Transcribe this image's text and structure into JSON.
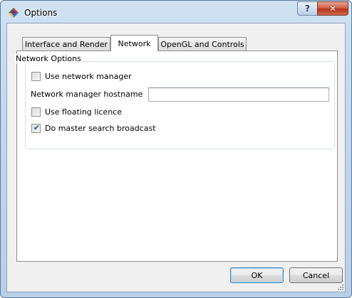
{
  "window": {
    "title": "Options",
    "help_label": "?",
    "close_label": "✕"
  },
  "tabs": [
    {
      "label": "Interface and Render",
      "active": false
    },
    {
      "label": "Network",
      "active": true
    },
    {
      "label": "OpenGL and Controls",
      "active": false
    }
  ],
  "network_options": {
    "group_title": "Network Options",
    "use_network_manager": {
      "label": "Use network manager",
      "checked": false
    },
    "hostname": {
      "label": "Network manager hostname",
      "value": "",
      "placeholder": ""
    },
    "use_floating_licence": {
      "label": "Use floating licence",
      "checked": false
    },
    "master_search_broadcast": {
      "label": "Do master search broadcast",
      "checked": true
    }
  },
  "buttons": {
    "ok_label": "OK",
    "cancel_label": "Cancel"
  },
  "icons": {
    "app": "app-diamond-icon",
    "help": "help-icon",
    "close": "close-icon",
    "check": "checkmark-icon",
    "grip": "resize-grip-icon"
  },
  "colors": {
    "frame": "#c1d6ec",
    "close_button": "#c7432b",
    "check_mark": "#2a4f8a",
    "default_button_border": "#3c7fb1"
  }
}
